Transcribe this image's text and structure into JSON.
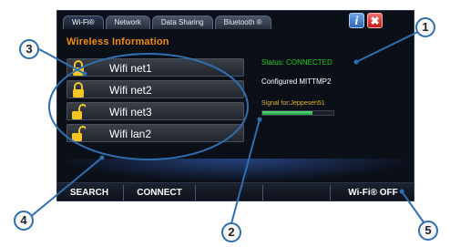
{
  "tabs": [
    {
      "label": "Wi-Fi®"
    },
    {
      "label": "Network"
    },
    {
      "label": "Data Sharing"
    },
    {
      "label": "Bluetooth ®"
    }
  ],
  "toolbar": {
    "info_icon_glyph": "i",
    "close_icon_glyph": "✖"
  },
  "section_title": "Wireless Information",
  "networks": [
    {
      "label": "Wifi net1",
      "lock": "locked"
    },
    {
      "label": "Wifi net2",
      "lock": "locked"
    },
    {
      "label": "Wifi net3",
      "lock": "unlocked"
    },
    {
      "label": "Wifi lan2",
      "lock": "unlocked"
    }
  ],
  "status": {
    "text": "Status: CONNECTED",
    "configured": "Configured MITTMP2",
    "signal_label": "Signal for:Jeppesen51",
    "signal_text": "",
    "signal_level": 0.7
  },
  "bottom_bar": {
    "search": "SEARCH",
    "connect": "CONNECT",
    "wifi_off": "Wi-Fi® OFF"
  },
  "callouts": [
    "1",
    "2",
    "3",
    "4",
    "5"
  ],
  "colors": {
    "accent_orange": "#f08c10",
    "status_green": "#22cc22",
    "callout_blue": "#2f6fb0",
    "lock_gold": "#f3c623"
  }
}
